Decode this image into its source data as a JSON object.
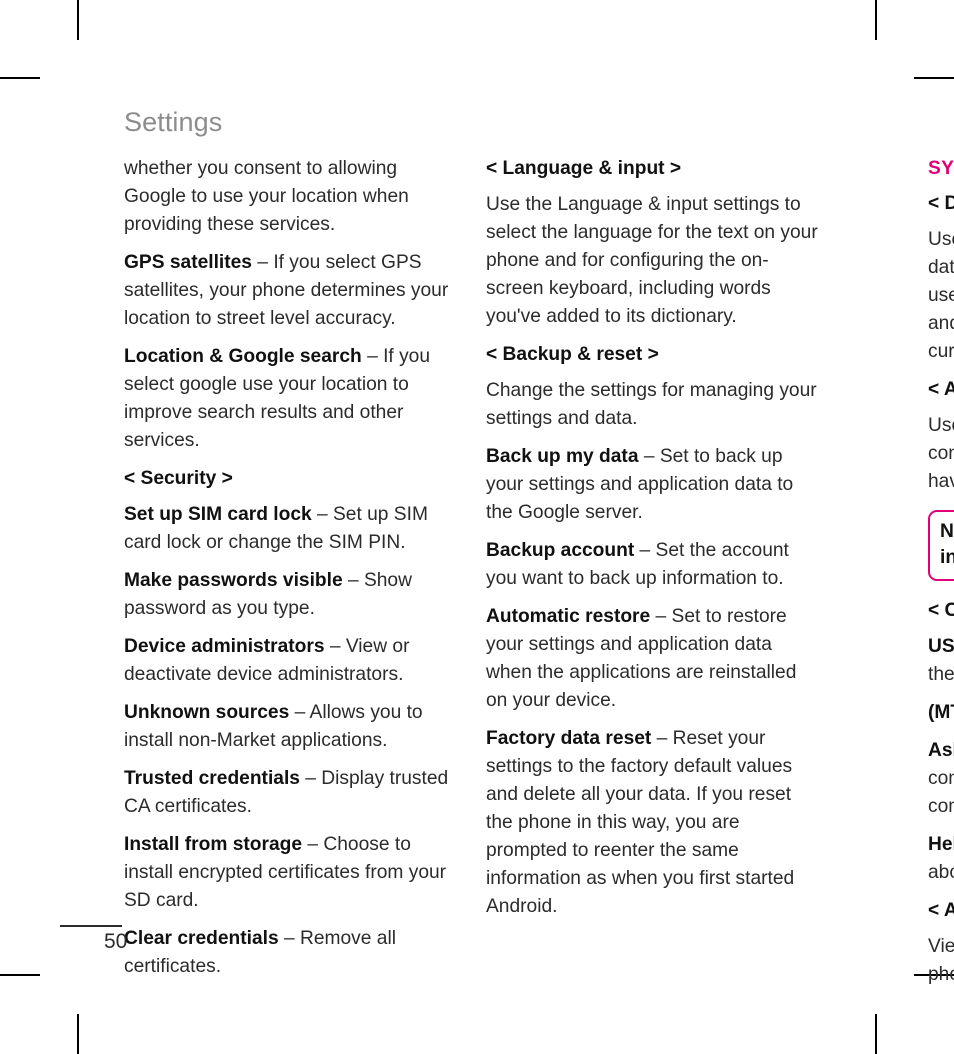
{
  "page": {
    "running_head": "Settings",
    "number": "50"
  },
  "columns": {
    "left": {
      "blocks": [
        {
          "kind": "paragraph",
          "body": "whether you consent to allowing Google to use your location when providing these services."
        },
        {
          "kind": "term",
          "term": "GPS satellites",
          "body": " – If you select GPS satellites, your phone determines your location to street level accuracy."
        },
        {
          "kind": "term",
          "term": "Location & Google search",
          "body": " – If you select google use your location to improve search results and other services."
        },
        {
          "kind": "section",
          "body": "< Security >"
        },
        {
          "kind": "term",
          "term": "Set up SIM card lock",
          "body": " – Set up SIM card lock or change the SIM PIN."
        },
        {
          "kind": "term",
          "term": "Make passwords visible",
          "body": " – Show password as you type."
        },
        {
          "kind": "term",
          "term": "Device administrators",
          "body": " – View or deactivate device administrators."
        },
        {
          "kind": "term",
          "term": "Unknown sources",
          "body": " – Allows you to install non-Market applications."
        },
        {
          "kind": "term",
          "term": "Trusted credentials",
          "body": " – Display trusted CA certificates."
        },
        {
          "kind": "term",
          "term": "Install from storage",
          "body": " – Choose to install encrypted certificates from your SD card."
        },
        {
          "kind": "term",
          "term": "Clear credentials",
          "body": " – Remove all certificates."
        }
      ]
    },
    "middle": {
      "blocks": [
        {
          "kind": "section",
          "body": "< Language & input >"
        },
        {
          "kind": "paragraph",
          "body": "Use the Language & input settings to select the language for the text on your phone and for configuring the on-screen keyboard, including words you've added to its dictionary."
        },
        {
          "kind": "section",
          "body": "< Backup & reset >"
        },
        {
          "kind": "paragraph",
          "body": "Change the settings for managing your settings and data."
        },
        {
          "kind": "term",
          "term": "Back up my data",
          "body": " – Set to back up your settings and application data to the Google server."
        },
        {
          "kind": "term",
          "term": "Backup account",
          "body": " – Set the account you want to back up information to."
        },
        {
          "kind": "term",
          "term": "Automatic restore",
          "body": " – Set to restore your settings and application data when the applications are reinstalled on your device."
        },
        {
          "kind": "term",
          "term": "Factory data reset",
          "body": " – Reset your settings to the factory default values and delete all your data. If you reset the phone in this way, you are prompted to reenter the same information as when you first started Android."
        }
      ]
    },
    "right_clipped": {
      "note": "This column is cut off by the page edge; only the first characters of each line are visible.",
      "blocks": [
        {
          "kind": "section-major",
          "body": "SYSTEM"
        },
        {
          "kind": "section",
          "body": "< Date & time >"
        },
        {
          "kind": "paragraph",
          "body": "Use the Date & time settings to set how dates will be displayed. You can also use these settings to set your own time and time zone rather than obtaining the current time from the mobile network."
        },
        {
          "kind": "section",
          "body": "< Accessibility >"
        },
        {
          "kind": "paragraph",
          "body": "Use the Accessibility settings to configure any accessibility plug-ins you have installed on your phone."
        },
        {
          "kind": "note",
          "body": "NOTE: Requires additional plug-ins."
        },
        {
          "kind": "section",
          "body": "< Connectivity >"
        },
        {
          "kind": "term",
          "term": "USB connection type",
          "body": " – You can set the desired mode "
        },
        {
          "kind": "term",
          "term": "(MTP, PC software, Mass storage)",
          "body": "."
        },
        {
          "kind": "term",
          "term": "Ask on connection",
          "body": " – Ask USB connection mode when connecting to a computer."
        },
        {
          "kind": "term",
          "term": "Help",
          "body": " – Shows you help information about USB connection."
        },
        {
          "kind": "section",
          "body": "< About phone >"
        },
        {
          "kind": "paragraph",
          "body": "View legal information and check phone status and software version."
        }
      ]
    }
  }
}
